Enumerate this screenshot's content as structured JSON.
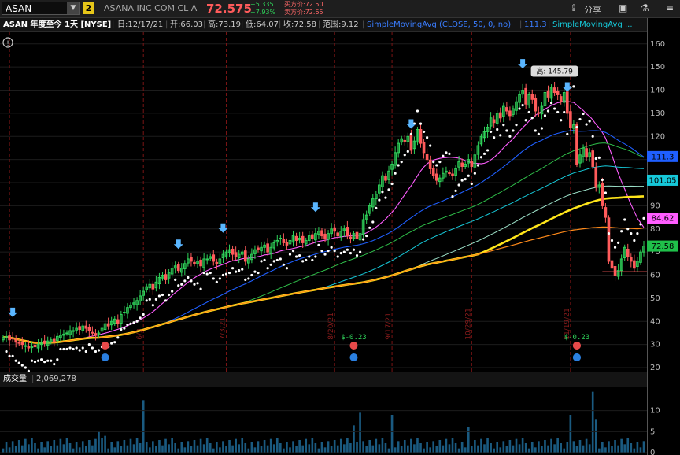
{
  "toolbar": {
    "symbol": "ASAN",
    "link_badge": "2",
    "company": "ASANA INC COM CL A",
    "last_price": "72.575",
    "change_abs": "+5.335",
    "change_pct": "+7.93%",
    "bid_label": "买方价:72.50",
    "ask_label": "卖方价:72.65",
    "share_label": "分享"
  },
  "header": {
    "title": "ASAN 年度至今 1天 [NYSE]",
    "date": "日:12/17/21",
    "open": "开:66.03",
    "high": "高:73.19",
    "low": "低:64.07",
    "close": "收:72.58",
    "range": "范围:9.12",
    "sma1_label": "SimpleMovingAvg (CLOSE, 50, 0, no)",
    "sma1_value": "111.3",
    "sma2_label": "SimpleMovingAvg ..."
  },
  "volume_header": {
    "label": "成交量",
    "value": "2,069,278"
  },
  "chart_data": {
    "type": "candlestick",
    "symbol": "ASAN",
    "y_ticks": [
      20,
      30,
      40,
      50,
      60,
      70,
      80,
      90,
      100,
      110,
      120,
      130,
      140,
      150,
      160
    ],
    "ylim": [
      20,
      163
    ],
    "volume_ticks": [
      0,
      5,
      10
    ],
    "volume_ylim": [
      0,
      15
    ],
    "high_callout": "高: 145.79",
    "high_value": 145.79,
    "price_tags": [
      {
        "value": 111.3,
        "label": "111.3",
        "color": "#1f5fff"
      },
      {
        "value": 101.05,
        "label": "101.05",
        "color": "#16c8d8"
      },
      {
        "value": 84.62,
        "label": "84.62",
        "color": "#ff5dff"
      },
      {
        "value": 72.58,
        "label": "72.58",
        "color": "#1fc04a"
      }
    ],
    "date_marks": [
      "6/3",
      "7/3/21",
      "8/20/21",
      "9/17/21",
      "10/29/21",
      "11/19/21"
    ],
    "dividend_labels": [
      "$-0.23",
      "$-0.23"
    ],
    "closes": [
      33,
      33.5,
      32,
      32.5,
      31,
      30.5,
      30,
      29.5,
      28.5,
      29,
      29,
      30,
      31,
      30.5,
      31.5,
      32,
      31,
      33.5,
      34,
      34.5,
      35,
      36,
      36,
      37,
      36.5,
      38,
      37,
      36,
      35,
      34,
      35,
      37,
      39,
      38,
      40,
      41,
      39,
      43,
      44,
      46,
      47,
      48,
      49,
      51,
      53,
      55,
      56,
      54,
      57,
      59,
      60,
      58,
      61,
      63,
      64,
      62,
      63,
      65,
      67,
      66,
      65,
      66,
      64,
      67,
      67,
      68,
      66,
      65,
      67,
      69,
      70,
      71,
      69,
      68,
      69,
      70,
      66,
      67,
      69,
      71,
      71,
      72,
      73,
      70,
      72,
      74,
      75,
      76,
      74,
      73,
      75,
      77,
      75,
      76,
      74,
      75,
      77,
      76,
      78,
      79,
      77,
      76,
      78,
      80,
      79,
      77,
      79,
      80,
      77,
      76,
      78,
      76,
      78,
      84,
      86,
      90,
      93,
      95,
      99,
      103,
      101,
      105,
      108,
      113,
      117,
      119,
      118,
      120,
      114,
      118,
      123,
      117,
      113,
      110,
      106,
      103,
      101,
      102,
      104,
      105,
      104,
      103,
      106,
      109,
      107,
      108,
      110,
      107,
      112,
      116,
      120,
      122,
      124,
      128,
      126,
      130,
      128,
      133,
      131,
      129,
      132,
      135,
      138,
      140,
      134,
      138,
      136,
      131,
      130,
      133,
      139,
      137,
      141,
      139,
      138,
      135,
      139,
      130,
      124,
      125,
      108,
      112,
      115,
      111,
      113,
      107,
      98,
      99,
      90,
      85,
      66,
      63,
      60,
      62,
      67,
      72,
      68,
      66,
      63,
      66,
      70,
      72.58
    ],
    "sma_periods_drawn": [
      "20",
      "50",
      "100",
      "150",
      "200"
    ]
  }
}
